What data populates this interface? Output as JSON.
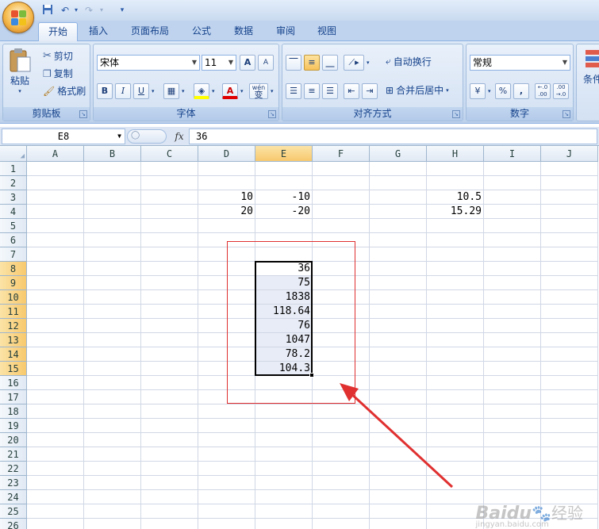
{
  "quick_access": {
    "icons": [
      "save-icon",
      "undo-icon",
      "redo-icon",
      "customize-icon"
    ]
  },
  "tabs": [
    {
      "label": "开始",
      "active": true
    },
    {
      "label": "插入"
    },
    {
      "label": "页面布局"
    },
    {
      "label": "公式"
    },
    {
      "label": "数据"
    },
    {
      "label": "审阅"
    },
    {
      "label": "视图"
    }
  ],
  "ribbon": {
    "clipboard": {
      "label": "剪贴板",
      "paste": "粘贴",
      "cut": "剪切",
      "copy": "复制",
      "format_painter": "格式刷"
    },
    "font": {
      "label": "字体",
      "font_name": "宋体",
      "font_size": "11",
      "bold": "B",
      "italic": "I",
      "underline": "U",
      "font_color_glyph": "A",
      "phonetic": "wén",
      "phonetic_char": "变",
      "grow": "A",
      "shrink": "A"
    },
    "alignment": {
      "label": "对齐方式",
      "wrap_text": "自动换行",
      "merge_center": "合并后居中"
    },
    "number": {
      "label": "数字",
      "format": "常规",
      "percent": "%",
      "comma": ",",
      "inc_decimal": "←.0 .00",
      "dec_decimal": ".00 →.0"
    },
    "styles": {
      "partial_label": "条件"
    }
  },
  "formula_bar": {
    "name_box": "E8",
    "fx": "fx",
    "value": "36"
  },
  "columns": [
    "A",
    "B",
    "C",
    "D",
    "E",
    "F",
    "G",
    "H",
    "I",
    "J"
  ],
  "selected_column": "E",
  "rows": [
    "1",
    "2",
    "3",
    "4",
    "5",
    "6",
    "7",
    "8",
    "9",
    "10",
    "11",
    "12",
    "13",
    "14",
    "15",
    "16",
    "17",
    "18",
    "19",
    "20",
    "21",
    "22",
    "23",
    "24",
    "25",
    "26"
  ],
  "selected_rows": [
    "8",
    "9",
    "10",
    "11",
    "12",
    "13",
    "14",
    "15"
  ],
  "cells": {
    "D3": "10",
    "E3": "-10",
    "H3": "10.5",
    "D4": "20",
    "E4": "-20",
    "H4": "15.29",
    "E8": "36",
    "E9": "75",
    "E10": "1838",
    "E11": "118.64",
    "E12": "76",
    "E13": "1047",
    "E14": "78.2",
    "E15": "104.3"
  },
  "selection": {
    "range": "E8:E15",
    "active": "E8"
  },
  "annotation_color": "#e03030",
  "watermark": {
    "brand": "Baidu",
    "brand_cn": "经验",
    "url": "jingyan.baidu.com"
  }
}
